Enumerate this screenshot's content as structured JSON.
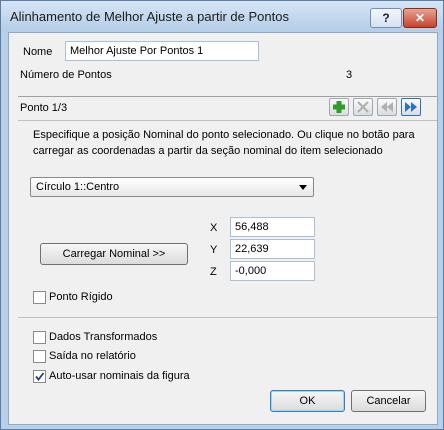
{
  "window": {
    "title": "Alinhamento de Melhor Ajuste a partir de Pontos",
    "help_label": "?",
    "close_label": "✕"
  },
  "form": {
    "name_label": "Nome",
    "name_value": "Melhor Ajuste Por Pontos 1",
    "points_count_label": "Número de Pontos",
    "points_count_value": "3"
  },
  "point_section": {
    "header": "Ponto 1/3",
    "instructions_line1": "Especifique a posição Nominal do ponto selecionado. Ou clique no botão para",
    "instructions_line2": "carregar as coordenadas a partir da seção nominal do item selecionado",
    "feature_select_value": "Círculo 1::Centro",
    "x_label": "X",
    "x_value": "56,488",
    "y_label": "Y",
    "y_value": "22,639",
    "z_label": "Z",
    "z_value": "-0,000",
    "load_nominal_label": "Carregar Nominal >>",
    "rigid_point_label": "Ponto Rígido",
    "rigid_point_checked": false
  },
  "toolbar_icons": [
    "add-point-icon",
    "remove-point-icon",
    "previous-point-icon",
    "next-point-icon"
  ],
  "options": {
    "transformed_data_label": "Dados Transformados",
    "transformed_data_checked": false,
    "report_output_label": "Saída no relatório",
    "report_output_checked": false,
    "auto_nominals_label": "Auto-usar nominais da figura",
    "auto_nominals_checked": true
  },
  "buttons": {
    "ok_label": "OK",
    "cancel_label": "Cancelar"
  },
  "colors": {
    "frame": "#b7cfe8",
    "add_icon": "#2e9b2e",
    "nav_active": "#2a6fc9",
    "default_button_border": "#3c7fb1"
  }
}
